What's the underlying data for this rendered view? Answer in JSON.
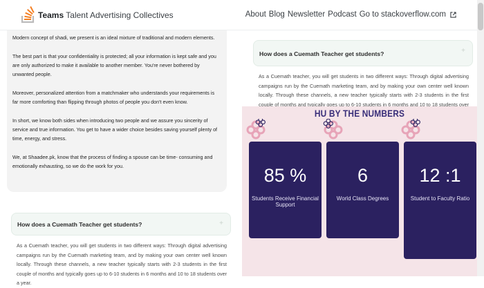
{
  "header": {
    "brand_bold": "Teams",
    "brand_rest": "Talent Advertising Collectives",
    "nav": [
      "About",
      "Blog",
      "Newsletter",
      "Podcast",
      "Go to stackoverflow.com"
    ]
  },
  "left_card": {
    "paragraphs": [
      "Modern concept of shadi, we present is an ideal mixture of traditional and modern elements.",
      "The best part is that your confidentiality is protected; all your information is kept safe and you are only authorized to make it available to another member. You're never bothered by unwanted people.",
      "Moreover, personalized attention from a matchmaker who understands your requirements is far more comforting than flipping through photos of people you don't even know.",
      "In short, we know both sides when introducing two people and we assure you sincerity of service and true information. You get to have a wider choice besides saving yourself plenty of time, energy, and stress.",
      "We, at Shaadee.pk, know that the process of finding a spouse can be time- consuming and emotionally exhausting, so we do the work for you."
    ]
  },
  "faq_top": {
    "title": "How does a Cuemath Teacher get students?",
    "plus": "+",
    "body": "As a Cuemath teacher, you will get students in two different ways: Through digital advertising campaigns run by the Cuemath marketing team, and by making your own center well known locally. Through these channels, a new teacher typically starts with 2-3 students in the first couple of months and typically goes up to 6-10 students in 6 months and 10 to 18 students over a year."
  },
  "faq_bottom": {
    "title": "How does a Cuemath Teacher get students?",
    "plus": "+",
    "body": "As a Cuemath teacher, you will get students in two different ways: Through digital advertising campaigns run by the Cuemath marketing team, and by making your own center well known locally. Through these channels, a new teacher typically starts with 2-3 students in the first couple of months and typically goes up to 6-10 students in 6 months and 10 to 18 students over a year."
  },
  "numbers": {
    "title": "HU BY THE NUMBERS",
    "stats": [
      {
        "value": "85 %",
        "label": "Students Receive Financial Support"
      },
      {
        "value": "6",
        "label": "World Class Degrees"
      },
      {
        "value": "12 :1",
        "label": "Student to Faculty Ratio"
      }
    ]
  },
  "colors": {
    "stat_bg": "#2b2160",
    "section_bg": "#f5e4e8",
    "flower_pink": "#e7a4b8",
    "flower_navy": "#2b2160",
    "logo_orange": "#f48024",
    "logo_gray": "#bcbbbb"
  },
  "icons": [
    "stackoverflow-logo-icon",
    "external-link-icon",
    "flower-icon",
    "plus-icon"
  ]
}
